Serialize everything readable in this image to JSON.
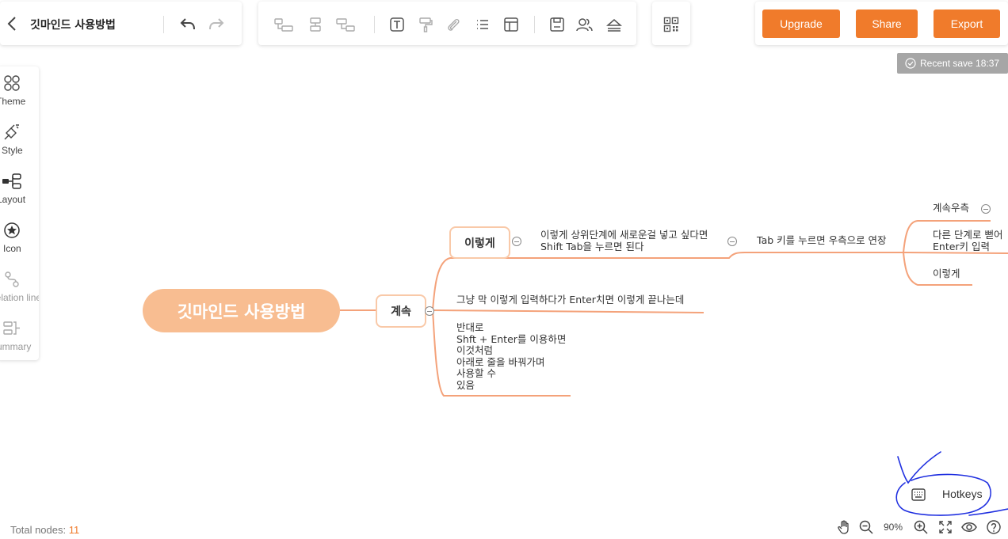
{
  "header": {
    "doc_title": "깃마인드 사용방법"
  },
  "actions": {
    "upgrade": "Upgrade",
    "share": "Share",
    "export": "Export",
    "accent": "#f07b2b"
  },
  "status": {
    "save_text": "Recent save 18:37"
  },
  "sidebar": {
    "items": [
      {
        "label": "Theme",
        "icon": "theme-icon"
      },
      {
        "label": "Style",
        "icon": "style-icon"
      },
      {
        "label": "Layout",
        "icon": "layout-icon"
      },
      {
        "label": "Icon",
        "icon": "star-icon"
      },
      {
        "label": "Relation line",
        "icon": "relation-line-icon"
      },
      {
        "label": "Summary",
        "icon": "summary-icon"
      }
    ]
  },
  "mindmap": {
    "root": "깃마인드 사용방법",
    "main_branch": "계속",
    "sub_branch_1": "이렇게",
    "sub1_text": "이렇게 상위단계에 새로운걸 넣고 싶다면\nShift Tab을 누르면 된다",
    "tab_text": "Tab 키를 누르면 우측으로 연장",
    "right_1": "계속우측",
    "right_2": "다른 단계로 뻗어\nEnter키 입력",
    "right_3": "이렇게",
    "branch_2": "그냥 막 이렇게 입력하다가 Enter치면 이렇게 끝나는데",
    "branch_3": "반대로\nShft + Enter를 이용하면\n이것처럼\n아래로 줄을 바꿔가며\n사용할 수\n있음",
    "line_color": "#f4a27a",
    "root_color": "#f8bd91"
  },
  "footer": {
    "total_label": "Total nodes: ",
    "total_count": "11",
    "hotkeys": "Hotkeys",
    "zoom": "90%"
  }
}
